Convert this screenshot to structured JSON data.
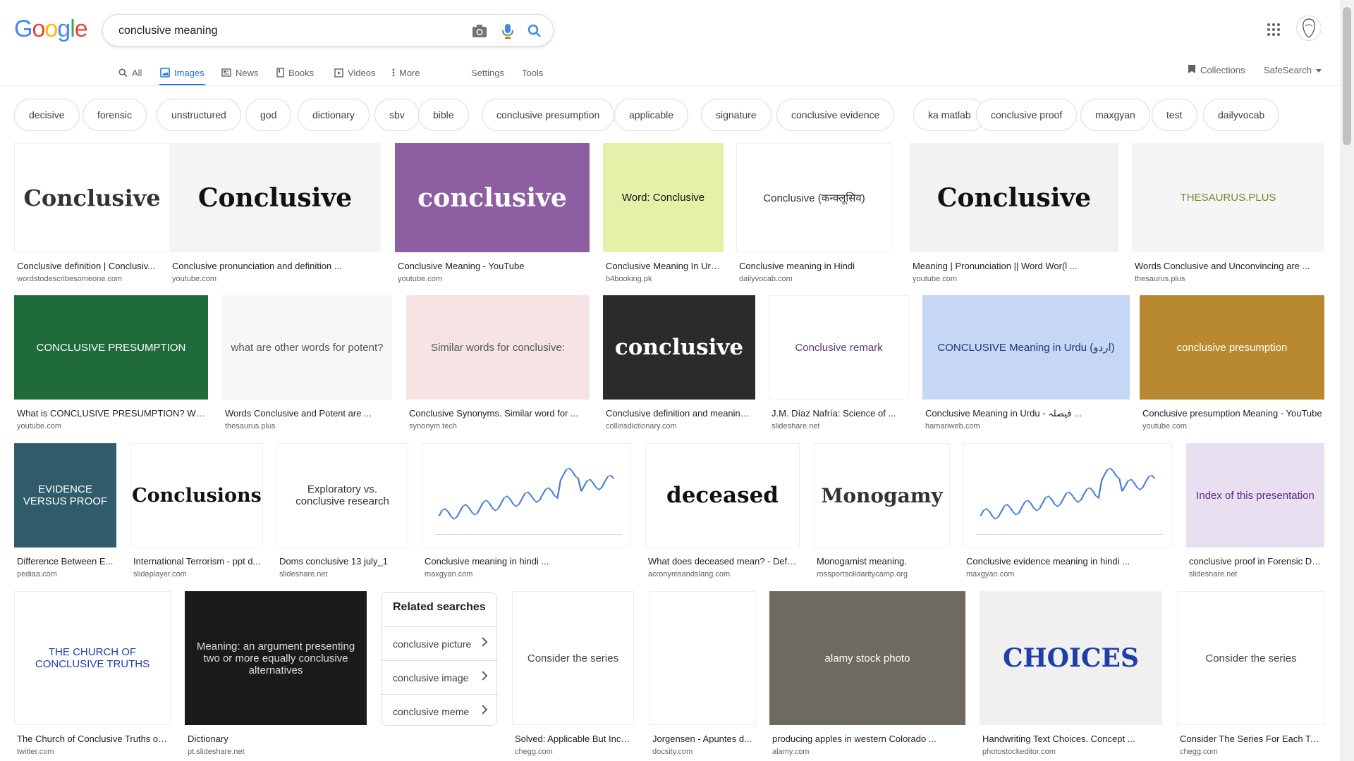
{
  "logo": {
    "letters": [
      "G",
      "o",
      "o",
      "g",
      "l",
      "e"
    ],
    "colors": [
      "#4285F4",
      "#EA4335",
      "#FBBC05",
      "#4285F4",
      "#34A853",
      "#EA4335"
    ]
  },
  "search": {
    "value": "conclusive meaning",
    "placeholder": ""
  },
  "icons": {
    "camera": "camera-icon",
    "mic": "microphone-icon",
    "search": "search-icon",
    "apps": "apps-grid-icon",
    "avatar": "account-avatar"
  },
  "tabs": [
    {
      "label": "All",
      "icon": "search-icon"
    },
    {
      "label": "Images",
      "icon": "image-icon",
      "active": true
    },
    {
      "label": "News",
      "icon": "news-icon"
    },
    {
      "label": "Books",
      "icon": "book-icon"
    },
    {
      "label": "Videos",
      "icon": "video-icon"
    },
    {
      "label": "More",
      "icon": "more-vert-icon"
    },
    {
      "label": "Settings"
    },
    {
      "label": "Tools"
    }
  ],
  "right_controls": {
    "collections": "Collections",
    "safesearch": "SafeSearch"
  },
  "chips": [
    "decisive",
    "forensic",
    "unstructured",
    "god",
    "dictionary",
    "sbv",
    "bible",
    "conclusive presumption",
    "applicable",
    "signature",
    "conclusive evidence",
    "ka matlab",
    "conclusive proof",
    "maxgyan",
    "test",
    "dailyvocab"
  ],
  "results": [
    {
      "caption": "Conclusive definition | Conclusiv...",
      "source": "wordstodescribesomeone.com",
      "thumb_text": "Conclusive",
      "bg": "#ffffff",
      "fg": "#333333"
    },
    {
      "caption": "Conclusive pronunciation and definition ...",
      "source": "youtube.com",
      "thumb_text": "Conclusive",
      "bg": "#f4f4f4",
      "fg": "#111111"
    },
    {
      "caption": "Conclusive Meaning - YouTube",
      "source": "youtube.com",
      "thumb_text": "conclusive",
      "bg": "#8e5ea2",
      "fg": "#ffffff"
    },
    {
      "caption": "Conclusive Meaning In Urd...",
      "source": "b4booking.pk",
      "thumb_text": "Word: Conclusive",
      "bg": "#e6f0a8",
      "fg": "#111111"
    },
    {
      "caption": "Conclusive meaning in Hindi",
      "source": "dailyvocab.com",
      "thumb_text": "Conclusive (कन्क्लूसिव)",
      "bg": "#ffffff",
      "fg": "#333333"
    },
    {
      "caption": "Meaning | Pronunciation || Word Wor(l ...",
      "source": "youtube.com",
      "thumb_text": "Conclusive",
      "bg": "#f2f2f2",
      "fg": "#111111"
    },
    {
      "caption": "Words Conclusive and Unconvincing are ...",
      "source": "thesaurus.plus",
      "thumb_text": "THESAURUS.PLUS",
      "bg": "#f5f5f5",
      "fg": "#6b8e23"
    },
    {
      "caption": "What is CONCLUSIVE PRESUMPTION? Wha...",
      "source": "youtube.com",
      "thumb_text": "CONCLUSIVE PRESUMPTION",
      "bg": "#1f6b3a",
      "fg": "#ffffff"
    },
    {
      "caption": "Words Conclusive and Potent are ...",
      "source": "thesaurus.plus",
      "thumb_text": "what are other words for potent?",
      "bg": "#f7f7f7",
      "fg": "#555555"
    },
    {
      "caption": "Conclusive Synonyms. Similar word for ...",
      "source": "synonym.tech",
      "thumb_text": "Similar words for conclusive:",
      "bg": "#f6e4e4",
      "fg": "#555555"
    },
    {
      "caption": "Conclusive definition and meaning ...",
      "source": "collinsdictionary.com",
      "thumb_text": "conclusive",
      "bg": "#2b2b2b",
      "fg": "#ffffff"
    },
    {
      "caption": "J.M. Díaz Nafría: Science of ...",
      "source": "slideshare.net",
      "thumb_text": "Conclusive remark",
      "bg": "#ffffff",
      "fg": "#5b3a7a"
    },
    {
      "caption": "Conclusive Meaning in Urdu - فیصلہ ...",
      "source": "hamariweb.com",
      "thumb_text": "CONCLUSIVE Meaning in Urdu (اردو)",
      "bg": "#c5d7f5",
      "fg": "#1e3a6e"
    },
    {
      "caption": "Conclusive presumption Meaning - YouTube",
      "source": "youtube.com",
      "thumb_text": "conclusive presumption",
      "bg": "#b8892e",
      "fg": "#ffffff"
    },
    {
      "caption": "Difference Between E...",
      "source": "pediaa.com",
      "thumb_text": "EVIDENCE VERSUS PROOF",
      "bg": "#2f5b6b",
      "fg": "#ffffff"
    },
    {
      "caption": "International Terrorism - ppt d...",
      "source": "slideplayer.com",
      "thumb_text": "Conclusions",
      "bg": "#ffffff",
      "fg": "#111111"
    },
    {
      "caption": "Doms conclusive 13 july_1",
      "source": "slideshare.net",
      "thumb_text": "Exploratory vs. conclusive research",
      "bg": "#ffffff",
      "fg": "#333333"
    },
    {
      "caption": "Conclusive meaning in hindi ...",
      "source": "maxgyan.com",
      "thumb_text": "",
      "bg": "#ffffff",
      "fg": "#4a7fd6"
    },
    {
      "caption": "What does deceased mean? - Defin...",
      "source": "acronymsandslang.com",
      "thumb_text": "deceased",
      "bg": "#ffffff",
      "fg": "#111111"
    },
    {
      "caption": "Monogamist meaning.",
      "source": "rossportsolidaritycamp.org",
      "thumb_text": "Monogamy",
      "bg": "#ffffff",
      "fg": "#333333"
    },
    {
      "caption": "Conclusive evidence meaning in hindi ...",
      "source": "maxgyan.com",
      "thumb_text": "",
      "bg": "#ffffff",
      "fg": "#4a7fd6"
    },
    {
      "caption": "conclusive proof in Forensic Da...",
      "source": "slideshare.net",
      "thumb_text": "Index of this presentation",
      "bg": "#e8e0f0",
      "fg": "#5b2c83"
    },
    {
      "caption": "The Church of Conclusive Truths on ...",
      "source": "twitter.com",
      "thumb_text": "THE CHURCH OF CONCLUSIVE TRUTHS",
      "bg": "#ffffff",
      "fg": "#1e3fa6"
    },
    {
      "caption": "Dictionary",
      "source": "pt.slideshare.net",
      "thumb_text": "Meaning: an argument presenting two or more equally conclusive alternatives",
      "bg": "#1a1a1a",
      "fg": "#dddddd"
    },
    {
      "caption": "Solved: Applicable But Inco...",
      "source": "chegg.com",
      "thumb_text": "Consider the series",
      "bg": "#ffffff",
      "fg": "#444444"
    },
    {
      "caption": "Jorgensen - Apuntes d...",
      "source": "docsity.com",
      "thumb_text": "",
      "bg": "#ffffff",
      "fg": "#444444"
    },
    {
      "caption": "producing apples in western Colorado ...",
      "source": "alamy.com",
      "thumb_text": "alamy stock photo",
      "bg": "#6e6a60",
      "fg": "#ffffff"
    },
    {
      "caption": "Handwriting Text Choices. Concept ...",
      "source": "photostockeditor.com",
      "thumb_text": "CHOICES",
      "bg": "#f0f0f0",
      "fg": "#1e3fa6"
    },
    {
      "caption": "Consider The Series For Each Tes...",
      "source": "chegg.com",
      "thumb_text": "Consider the series",
      "bg": "#ffffff",
      "fg": "#444444"
    }
  ],
  "related": {
    "title": "Related searches",
    "items": [
      "conclusive picture",
      "conclusive image",
      "conclusive meme"
    ]
  }
}
